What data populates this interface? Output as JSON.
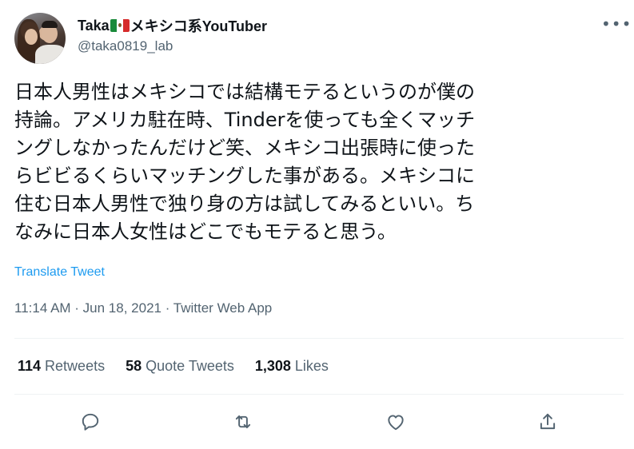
{
  "user": {
    "display_name_prefix": "Taka",
    "display_name_suffix": "メキシコ系YouTuber",
    "flag_icon": "mexico-flag-icon",
    "handle": "@taka0819_lab",
    "more_icon": "more-options-icon"
  },
  "tweet": {
    "lines": [
      "日本人男性はメキシコでは結構モテるというのが僕の",
      "持論。アメリカ駐在時、Tinderを使っても全くマッチ",
      "ングしなかったんだけど笑、メキシコ出張時に使った",
      "らビビるくらいマッチングした事がある。メキシコに",
      "住む日本人男性で独り身の方は試してみるといい。ち",
      "なみに日本人女性はどこでもモテると思う。"
    ],
    "translate_label": "Translate Tweet",
    "timestamp": "11:14 AM · Jun 18, 2021 · Twitter Web App"
  },
  "stats": {
    "retweets_count": "114",
    "retweets_label": "Retweets",
    "quotes_count": "58",
    "quotes_label": "Quote Tweets",
    "likes_count": "1,308",
    "likes_label": "Likes"
  },
  "actions": {
    "reply_icon": "reply-icon",
    "retweet_icon": "retweet-icon",
    "like_icon": "like-icon",
    "share_icon": "share-icon"
  },
  "colors": {
    "link": "#1d9bf0",
    "secondary_text": "#536471",
    "primary_text": "#0f1419"
  }
}
